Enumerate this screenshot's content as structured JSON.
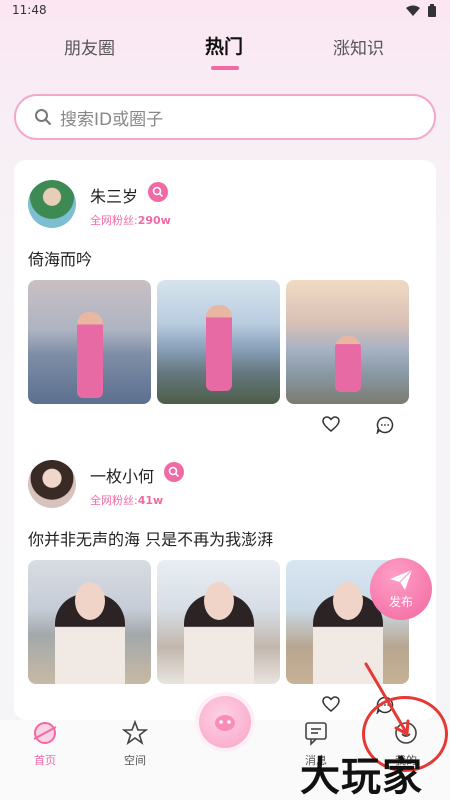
{
  "status_bar": {
    "time": "11:48"
  },
  "tabs": [
    {
      "label": "朋友圈"
    },
    {
      "label": "热门"
    },
    {
      "label": "涨知识"
    }
  ],
  "search": {
    "placeholder": "搜索ID或圈子"
  },
  "posts": [
    {
      "username": "朱三岁",
      "fans_label": "全网粉丝:",
      "fans_count": "290w",
      "text": "倚海而吟"
    },
    {
      "username": "一枚小何",
      "fans_label": "全网粉丝:",
      "fans_count": "41w",
      "text": "你并非无声的海 只是不再为我澎湃"
    }
  ],
  "fab": {
    "label": "发布"
  },
  "bottom_nav": [
    {
      "label": "首页"
    },
    {
      "label": "空间"
    },
    {
      "label": "消息"
    },
    {
      "label": "我的"
    }
  ],
  "watermark": "大玩家",
  "colors": {
    "accent": "#f06aa6",
    "annotation": "#e53935"
  }
}
